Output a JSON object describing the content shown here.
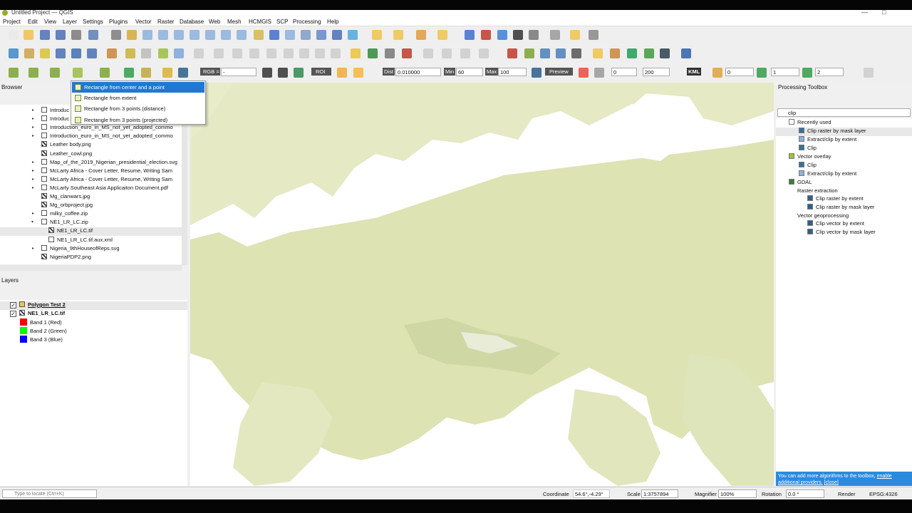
{
  "title_bar": {
    "title": "Untitled Project — QGIS"
  },
  "menu": [
    "Project",
    "Edit",
    "View",
    "Layer",
    "Settings",
    "Plugins",
    "Vector",
    "Raster",
    "Database",
    "Web",
    "Mesh",
    "HCMGIS",
    "SCP",
    "Processing",
    "Help"
  ],
  "scp_toolbar": {
    "rgb_label": "RGB =",
    "rgb_value": "-",
    "roi_label": "ROI",
    "dist_label": "Dist",
    "dist_value": "0.010000",
    "min_label": "Min",
    "min_value": "60",
    "max_label": "Max",
    "max_value": "100",
    "preview_label": "Preview",
    "val_a": "0",
    "val_b": "200",
    "kml_label": "KML",
    "band_a": "0",
    "band_b": "1",
    "band_c": "2"
  },
  "dropdown": {
    "items": [
      {
        "label": "Rectangle from center and a point",
        "selected": true
      },
      {
        "label": "Rectangle from extent",
        "selected": false
      },
      {
        "label": "Rectangle from 3 points (distance)",
        "selected": false
      },
      {
        "label": "Rectangle from 3 points (projected)",
        "selected": false
      }
    ]
  },
  "browser": {
    "title": "Browser",
    "items": [
      {
        "label": "Introduc",
        "kind": "zip"
      },
      {
        "label": "Introduc",
        "kind": "zip"
      },
      {
        "label": "Introduction_euro_in_MS_not_yet_adopted_commo",
        "kind": "zip"
      },
      {
        "label": "Introduction_euro_in_MS_not_yet_adopted_commo",
        "kind": "zip"
      },
      {
        "label": "Leather body.png",
        "kind": "raster"
      },
      {
        "label": "Leather_cowl.png",
        "kind": "raster"
      },
      {
        "label": "Map_of_the_2019_Nigerian_presidential_election.svg",
        "kind": "svg"
      },
      {
        "label": "McLarty Africa - Cover Letter, Resume, Writing Sam",
        "kind": "doc"
      },
      {
        "label": "McLarty Africa - Cover Letter, Resume, Writing Sam",
        "kind": "doc"
      },
      {
        "label": "McLarty Southeast Asia Applicaiton Document.pdf",
        "kind": "doc"
      },
      {
        "label": "Mg_clanwars.jpg",
        "kind": "raster"
      },
      {
        "label": "Mg_orbproject.jpg",
        "kind": "raster"
      },
      {
        "label": "milky_coffee.zip",
        "kind": "zip"
      },
      {
        "label": "NE1_LR_LC.zip",
        "kind": "zip"
      },
      {
        "label": "NE1_LR_LC.tif",
        "kind": "raster"
      },
      {
        "label": "NE1_LR_LC.tif.aux.xml",
        "kind": "doc"
      },
      {
        "label": "Nigeria_9thHouseofReps.svg",
        "kind": "svg"
      },
      {
        "label": "NigeriaPDP2.png",
        "kind": "raster"
      }
    ]
  },
  "layers": {
    "title": "Layers",
    "items": [
      {
        "label": "Polygon Test 2",
        "checked": true,
        "bold": true
      },
      {
        "label": "NE1_LR_LC.tif",
        "checked": true,
        "bold": true
      }
    ],
    "bands": [
      {
        "label": "Band 1 (Red)",
        "color": "#ff0000"
      },
      {
        "label": "Band 2 (Green)",
        "color": "#00ff00"
      },
      {
        "label": "Band 3 (Blue)",
        "color": "#0000ff"
      }
    ]
  },
  "toolbox": {
    "title": "Processing Toolbox",
    "search_value": "clip",
    "groups": [
      {
        "label": "Recently used",
        "items": [
          "Clip raster by mask layer",
          "Extract/clip by extent",
          "Clip"
        ]
      },
      {
        "label": "Vector overlay",
        "items": [
          "Clip",
          "Extract/clip by extent"
        ]
      },
      {
        "label": "GDAL",
        "subgroups": [
          {
            "label": "Raster extraction",
            "items": [
              "Clip raster by extent",
              "Clip raster by mask layer"
            ]
          },
          {
            "label": "Vector geoprocessing",
            "items": [
              "Clip vector by extent",
              "Clip vector by mask layer"
            ]
          }
        ]
      }
    ],
    "notice": {
      "text": "You can add more algorithms to the toolbox,",
      "link1": "enable additional providers.",
      "link2": "[close]"
    }
  },
  "status": {
    "locate_placeholder": "Type to locate (Ctrl+K)",
    "coordinate_label": "Coordinate",
    "coordinate_value": "54.6°,-4.29°",
    "scale_label": "Scale",
    "scale_value": "1:3757894",
    "magnifier_label": "Magnifier",
    "magnifier_value": "100%",
    "rotation_label": "Rotation",
    "rotation_value": "0.0 °",
    "render_label": "Render",
    "crs": "EPSG:4326"
  },
  "colors": {
    "accent": "#1f78d1",
    "map_land": "#e7ebc6",
    "map_water": "#ffffff",
    "notice_bg": "#2a8ae0"
  }
}
